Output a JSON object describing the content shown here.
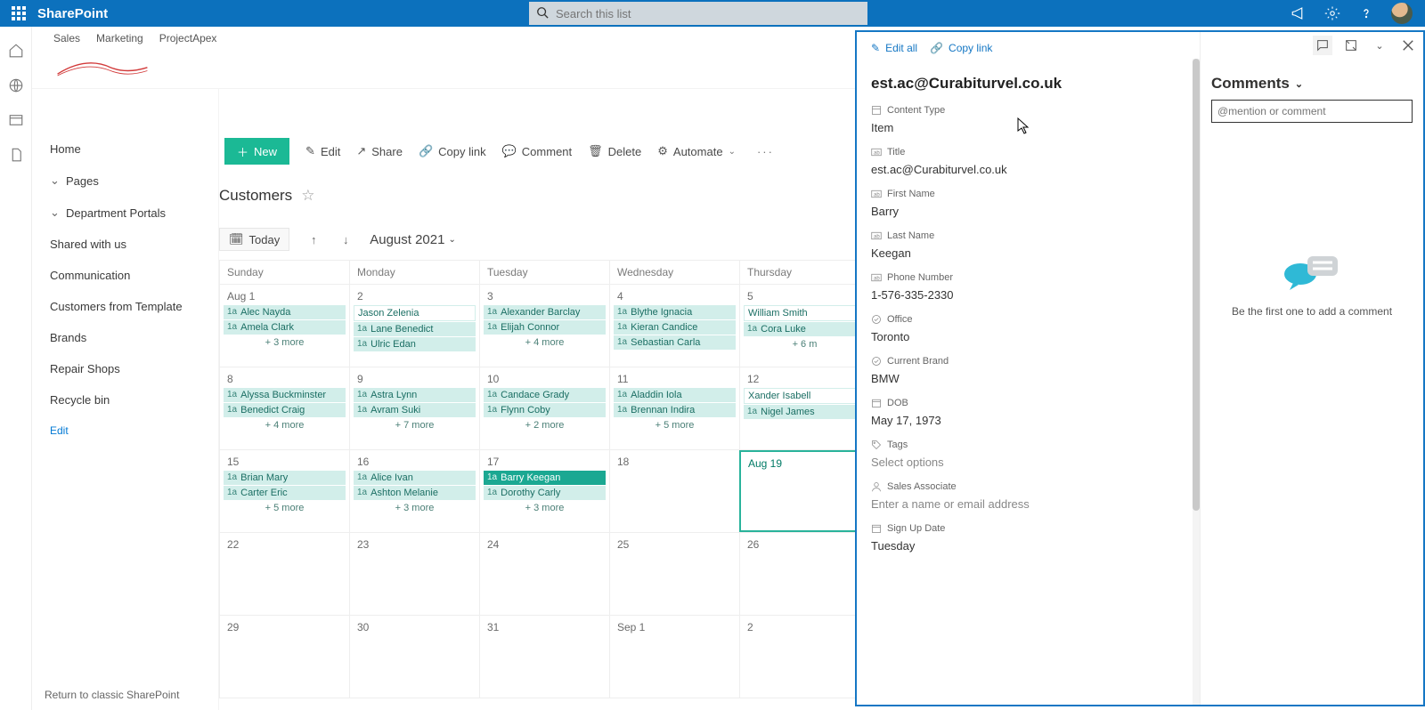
{
  "header": {
    "brand": "SharePoint",
    "search_placeholder": "Search this list"
  },
  "site_tabs": [
    "Sales",
    "Marketing",
    "ProjectApex"
  ],
  "nav": {
    "home": "Home",
    "pages": "Pages",
    "dept": "Department Portals",
    "shared": "Shared with us",
    "comm": "Communication",
    "cust": "Customers from Template",
    "brands": "Brands",
    "repair": "Repair Shops",
    "recycle": "Recycle bin",
    "edit": "Edit",
    "return": "Return to classic SharePoint"
  },
  "cmd": {
    "new": "New",
    "edit": "Edit",
    "share": "Share",
    "copy": "Copy link",
    "comment": "Comment",
    "delete": "Delete",
    "automate": "Automate"
  },
  "list_title": "Customers",
  "cal": {
    "today": "Today",
    "month": "August 2021",
    "dow": [
      "Sunday",
      "Monday",
      "Tuesday",
      "Wednesday",
      "Thursday"
    ],
    "weeks": [
      [
        {
          "d": "Aug 1",
          "ev": [
            {
              "t": "1a",
              "n": "Alec Nayda"
            },
            {
              "t": "1a",
              "n": "Amela Clark"
            }
          ],
          "more": "+ 3 more"
        },
        {
          "d": "2",
          "ev": [
            {
              "t": "",
              "n": "Jason Zelenia",
              "w": true
            },
            {
              "t": "1a",
              "n": "Lane Benedict"
            },
            {
              "t": "1a",
              "n": "Ulric Edan"
            }
          ]
        },
        {
          "d": "3",
          "ev": [
            {
              "t": "1a",
              "n": "Alexander Barclay"
            },
            {
              "t": "1a",
              "n": "Elijah Connor"
            }
          ],
          "more": "+ 4 more"
        },
        {
          "d": "4",
          "ev": [
            {
              "t": "1a",
              "n": "Blythe Ignacia"
            },
            {
              "t": "1a",
              "n": "Kieran Candice"
            },
            {
              "t": "1a",
              "n": "Sebastian Carla"
            }
          ]
        },
        {
          "d": "5",
          "ev": [
            {
              "t": "",
              "n": "William Smith",
              "w": true
            },
            {
              "t": "1a",
              "n": "Cora Luke"
            }
          ],
          "more": "+ 6 m"
        }
      ],
      [
        {
          "d": "8",
          "ev": [
            {
              "t": "1a",
              "n": "Alyssa Buckminster"
            },
            {
              "t": "1a",
              "n": "Benedict Craig"
            }
          ],
          "more": "+ 4 more"
        },
        {
          "d": "9",
          "ev": [
            {
              "t": "1a",
              "n": "Astra Lynn"
            },
            {
              "t": "1a",
              "n": "Avram Suki"
            }
          ],
          "more": "+ 7 more"
        },
        {
          "d": "10",
          "ev": [
            {
              "t": "1a",
              "n": "Candace Grady"
            },
            {
              "t": "1a",
              "n": "Flynn Coby"
            }
          ],
          "more": "+ 2 more"
        },
        {
          "d": "11",
          "ev": [
            {
              "t": "1a",
              "n": "Aladdin Iola"
            },
            {
              "t": "1a",
              "n": "Brennan Indira"
            }
          ],
          "more": "+ 5 more"
        },
        {
          "d": "12",
          "ev": [
            {
              "t": "",
              "n": "Xander Isabell",
              "w": true
            },
            {
              "t": "1a",
              "n": "Nigel James"
            }
          ]
        }
      ],
      [
        {
          "d": "15",
          "ev": [
            {
              "t": "1a",
              "n": "Brian Mary"
            },
            {
              "t": "1a",
              "n": "Carter Eric"
            }
          ],
          "more": "+ 5 more"
        },
        {
          "d": "16",
          "ev": [
            {
              "t": "1a",
              "n": "Alice Ivan"
            },
            {
              "t": "1a",
              "n": "Ashton Melanie"
            }
          ],
          "more": "+ 3 more"
        },
        {
          "d": "17",
          "ev": [
            {
              "t": "1a",
              "n": "Barry Keegan",
              "sel": true
            },
            {
              "t": "1a",
              "n": "Dorothy Carly"
            }
          ],
          "more": "+ 3 more"
        },
        {
          "d": "18",
          "ev": []
        },
        {
          "d": "Aug 19",
          "ev": [],
          "today": true
        }
      ],
      [
        {
          "d": "22",
          "ev": []
        },
        {
          "d": "23",
          "ev": []
        },
        {
          "d": "24",
          "ev": []
        },
        {
          "d": "25",
          "ev": []
        },
        {
          "d": "26",
          "ev": []
        }
      ],
      [
        {
          "d": "29",
          "ev": []
        },
        {
          "d": "30",
          "ev": []
        },
        {
          "d": "31",
          "ev": []
        },
        {
          "d": "Sep 1",
          "ev": []
        },
        {
          "d": "2",
          "ev": []
        }
      ]
    ]
  },
  "panel": {
    "edit_all": "Edit all",
    "copy_link": "Copy link",
    "title": "est.ac@Curabiturvel.co.uk",
    "fields": [
      {
        "icon": "content",
        "label": "Content Type",
        "value": "Item"
      },
      {
        "icon": "text",
        "label": "Title",
        "value": "est.ac@Curabiturvel.co.uk"
      },
      {
        "icon": "text",
        "label": "First Name",
        "value": "Barry"
      },
      {
        "icon": "text",
        "label": "Last Name",
        "value": "Keegan"
      },
      {
        "icon": "text",
        "label": "Phone Number",
        "value": "1-576-335-2330"
      },
      {
        "icon": "choice",
        "label": "Office",
        "value": "Toronto"
      },
      {
        "icon": "choice",
        "label": "Current Brand",
        "value": "BMW"
      },
      {
        "icon": "date",
        "label": "DOB",
        "value": "May 17, 1973"
      },
      {
        "icon": "tag",
        "label": "Tags",
        "value": "Select options",
        "ph": true
      },
      {
        "icon": "person",
        "label": "Sales Associate",
        "value": "Enter a name or email address",
        "ph": true
      },
      {
        "icon": "date",
        "label": "Sign Up Date",
        "value": "Tuesday"
      }
    ],
    "comments_heading": "Comments",
    "comment_placeholder": "@mention or comment",
    "empty_text": "Be the first one to add a comment"
  }
}
